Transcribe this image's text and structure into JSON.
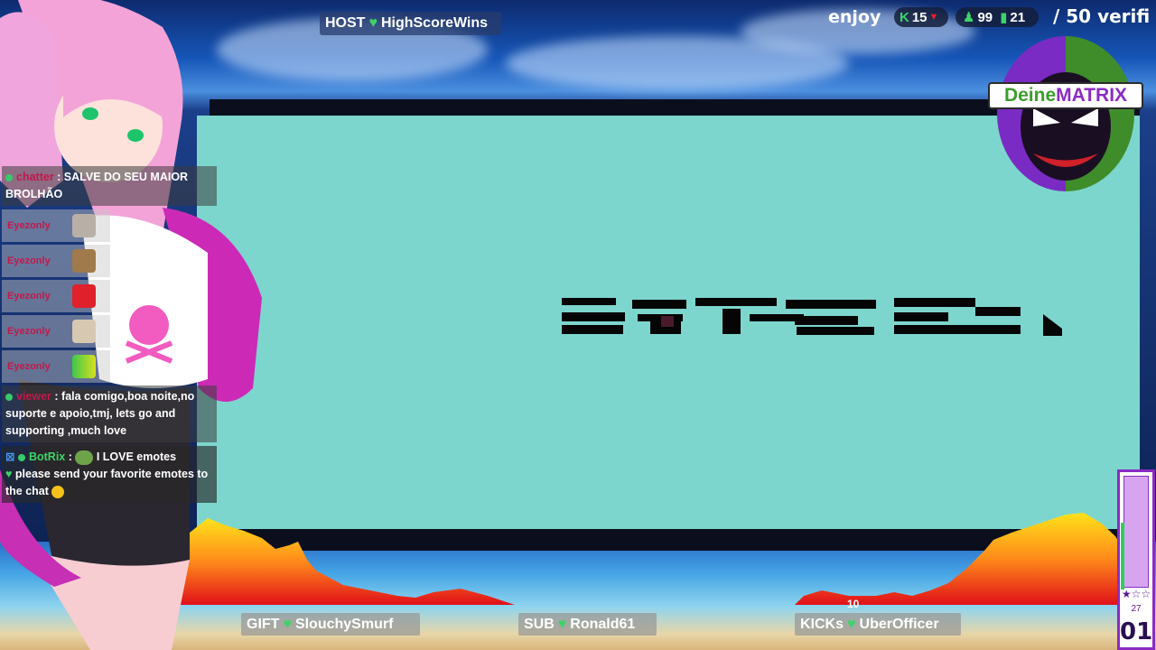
{
  "top": {
    "host_label": "HOST",
    "host_name": "HighScoreWins",
    "enjoy": "enjoy",
    "kick_count": "15",
    "viewers_a": "99",
    "viewers_b": "21",
    "goal_text": "/ 50 verifi"
  },
  "logo": {
    "part_a": "Deine",
    "part_b": "MATRIX"
  },
  "chat": {
    "msg1_user": "chatter",
    "msg1_text": ": SALVE DO SEU MAIOR BROLHÃO",
    "emote_user": "Eyezonly",
    "msg2_user": "viewer",
    "msg2_text": ": fala comigo,boa noite,no suporte e apoio,tmj, lets go and supporting ,much love",
    "bot_user": "BotRix",
    "bot_text1": "I LOVE emotes",
    "bot_text2": "please send your favorite emotes to the chat"
  },
  "bottom": {
    "gift_label": "GIFT",
    "gift_name": "SlouchySmurf",
    "sub_label": "SUB",
    "sub_name": "Ronald61",
    "kick_label": "KICKs",
    "kick_name": "UberOfficer",
    "kick_count_small": "10"
  },
  "meter": {
    "stars": "★☆☆",
    "small": "27",
    "level": "01",
    "fill_fraction": 0.62
  },
  "colors": {
    "accent_green": "#3ed36a",
    "accent_purple": "#8b2bc4",
    "video_bg": "#7dd6cd"
  }
}
